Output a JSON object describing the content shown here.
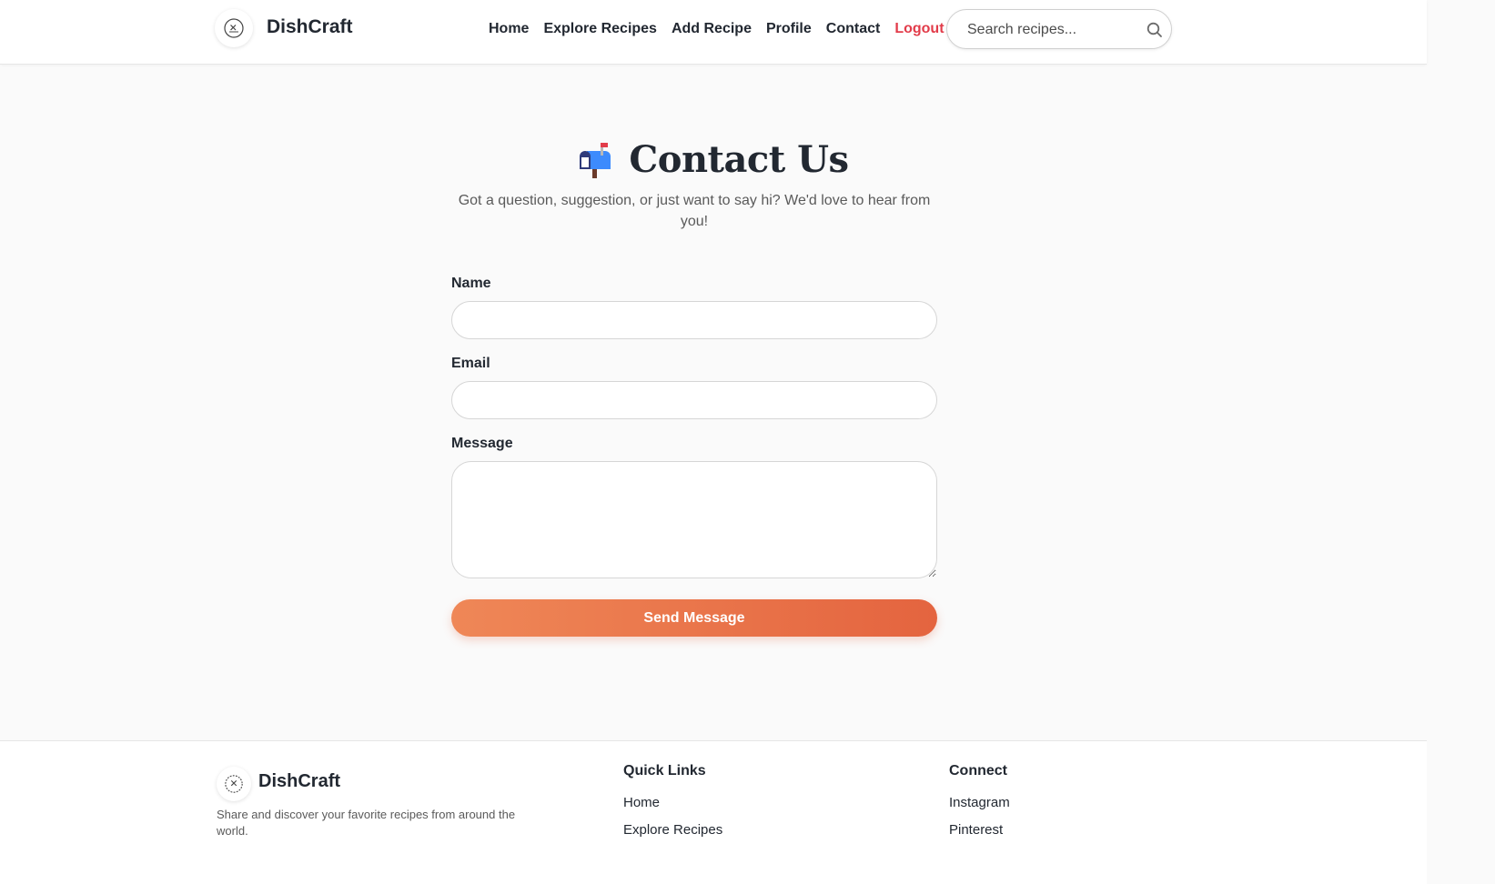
{
  "header": {
    "brand": "DishCraft",
    "nav": [
      {
        "label": "Home"
      },
      {
        "label": "Explore Recipes"
      },
      {
        "label": "Add Recipe"
      },
      {
        "label": "Profile"
      },
      {
        "label": "Contact"
      },
      {
        "label": "Logout"
      }
    ],
    "search_placeholder": "Search recipes..."
  },
  "hero": {
    "icon": "mailbox-icon",
    "title": "Contact Us",
    "subtitle": "Got a question, suggestion, or just want to say hi? We'd love to hear from you!"
  },
  "form": {
    "name_label": "Name",
    "name_value": "",
    "email_label": "Email",
    "email_value": "",
    "message_label": "Message",
    "message_value": "",
    "submit_label": "Send Message"
  },
  "footer": {
    "brand": "DishCraft",
    "description": "Share and discover your favorite recipes from around the world.",
    "quick_links_heading": "Quick Links",
    "quick_links": [
      {
        "label": "Home"
      },
      {
        "label": "Explore Recipes"
      }
    ],
    "connect_heading": "Connect",
    "connect_links": [
      {
        "label": "Instagram"
      },
      {
        "label": "Pinterest"
      }
    ]
  },
  "colors": {
    "accent_start": "#ef8757",
    "accent_end": "#e4643f",
    "logout": "#e23c4a",
    "text": "#222831"
  }
}
